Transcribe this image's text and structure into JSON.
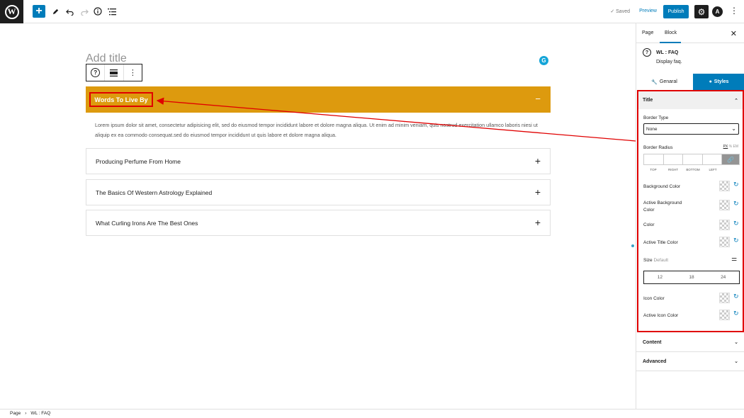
{
  "topbar": {
    "add_icon": "+",
    "edit_icon": "pencil-icon",
    "undo_icon": "undo-icon",
    "redo_icon": "redo-icon",
    "info_icon": "info-icon",
    "list_view_icon": "list-view-icon",
    "saved_label": "✓ Saved",
    "preview_label": "Preview",
    "publish_label": "Publish",
    "settings_icon": "⚙",
    "astra_label": "A",
    "more_icon": "⋮"
  },
  "editor": {
    "title_placeholder": "Add title",
    "faq": {
      "active_title": "Words To Live By",
      "active_icon": "−",
      "active_body": "Lorem ipsum dolor sit amet, consectetur adipisicing elit, sed do eiusmod tempor incididunt labore et dolore magna aliqua. Ut enim ad minim veniam, quis nostrud exercitation ullamco laboris niesi ut aliquip ex ea commodo consequat.sed do eiusmod tempor incididunt ut quis labore et dolore magna aliqua.",
      "items": [
        {
          "title": "Producing Perfume From Home",
          "icon": "+"
        },
        {
          "title": "The Basics Of Western Astrology Explained",
          "icon": "+"
        },
        {
          "title": "What Curling Irons Are The Best Ones",
          "icon": "+"
        }
      ]
    }
  },
  "sidebar": {
    "tabs": {
      "page": "Page",
      "block": "Block"
    },
    "close_icon": "✕",
    "block_name": "WL : FAQ",
    "block_desc": "Display faq.",
    "subtabs": {
      "general": "Genaral",
      "styles": "Styles"
    },
    "title_panel": {
      "heading": "Title",
      "border_type_label": "Border Type",
      "border_type_value": "None",
      "border_radius_label": "Border Radius",
      "units": [
        "PX",
        "%",
        "EM"
      ],
      "radius_sides": [
        "TOP",
        "RIGHT",
        "BOTTOM",
        "LEFT"
      ],
      "background_color_label": "Background Color",
      "active_background_color_label": "Active Background Color",
      "color_label": "Color",
      "active_title_color_label": "Active Title Color",
      "size_label": "Size",
      "size_default": "Default",
      "size_presets": [
        "12",
        "18",
        "24"
      ],
      "icon_color_label": "Icon Color",
      "active_icon_color_label": "Active Icon Color"
    },
    "content_label": "Content",
    "advanced_label": "Advanced"
  },
  "footer": {
    "crumb_page": "Page",
    "crumb_sep": "›",
    "crumb_block": "WL : FAQ"
  },
  "colors": {
    "accent": "#007cba",
    "faq_active_bg": "#dd9a0e",
    "highlight": "#e00000"
  }
}
